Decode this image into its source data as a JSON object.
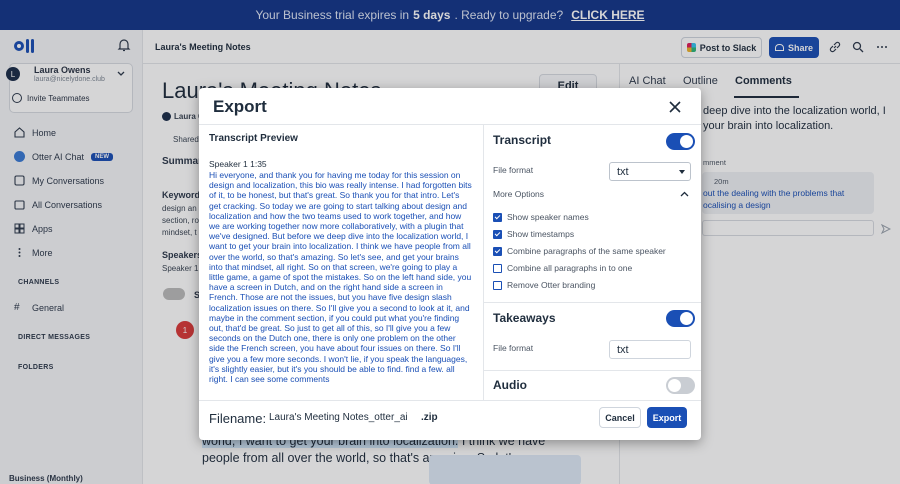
{
  "banner": {
    "prefix": "Your Business trial expires in",
    "days": "5 days",
    "mid": ". Ready to upgrade?",
    "cta": "CLICK HERE"
  },
  "sidebar": {
    "user_initial": "L",
    "user_name": "Laura Owens",
    "user_email": "laura@nicelydone.club",
    "invite": "Invite Teammates",
    "items": [
      {
        "label": "Home",
        "icon": "home-icon"
      },
      {
        "label": "Otter AI Chat",
        "icon": "otter-icon",
        "badge": "NEW"
      },
      {
        "label": "My Conversations",
        "icon": "conversations-icon"
      },
      {
        "label": "All Conversations",
        "icon": "folder-icon"
      },
      {
        "label": "Apps",
        "icon": "apps-icon"
      },
      {
        "label": "More",
        "icon": "more-icon"
      }
    ],
    "channels": "CHANNELS",
    "general": "General",
    "direct": "DIRECT MESSAGES",
    "folders": "FOLDERS",
    "plan": "Business (Monthly)"
  },
  "topbar": {
    "title": "Laura's Meeting Notes",
    "slack": "Post to Slack",
    "share": "Share"
  },
  "main_bg": {
    "title": "Laura's Meeting Notes",
    "edit": "Edit",
    "owner": "Laura O",
    "shared": "Shared",
    "summary": "Summar",
    "keywords": "Keyword",
    "kw1": "design an",
    "kw2": "section, ro",
    "kw3": "mindset, t",
    "speakers": "Speakers",
    "speaker": "Speaker 1",
    "s_label": "S",
    "speaker_num": "1",
    "transcript_a": "world, I want to get your brain into localization.",
    "transcript_b": " I think we have people from all over the world, so that's amazing. So let's"
  },
  "right_panel": {
    "tabs": [
      "AI Chat",
      "Outline",
      "Comments"
    ],
    "heading": "deep dive into the localization world, I your brain into localization.",
    "comment_label": "mment",
    "time": "20m",
    "comment_text": "out the dealing with the problems that ocalising a design"
  },
  "modal": {
    "title": "Export",
    "preview_title": "Transcript Preview",
    "speaker_line": "Speaker 1  1:35",
    "preview_text": "Hi everyone, and thank you for having me today for this session on design and localization, this bio was really intense. I had forgotten bits of it, to be honest, but that's great. So thank you for that intro. Let's get cracking. So today we are going to start talking about design and localization and how the two teams used to work together, and how we are working together now more collaboratively, with a plugin that we've designed. But before we deep dive into the localization world, I want to get your brain into localization. I think we have people from all over the world, so that's amazing. So let's see, and get your brains into that mindset, all right. So on that screen, we're going to play a little game, a game of spot the mistakes. So on the left hand side, you have a screen in Dutch, and on the right hand side a screen in French. Those are not the issues, but you have five design slash localization issues on there. So I'll give you a second to look at it, and maybe in the comment section, if you could put what you're finding out, that'd be great. So just to get all of this, so I'll give you a few seconds on the Dutch one, there is only one problem on the other side the French screen, you have about four issues on there. So I'll give you a few more seconds. I won't lie, if you speak the languages, it's slightly easier, but it's you should be able to find. find a few. all right. I can see some comments",
    "transcript": {
      "heading": "Transcript",
      "file_format_label": "File format",
      "format": "txt",
      "more_options": "More Options"
    },
    "options": [
      {
        "label": "Show speaker names",
        "checked": true
      },
      {
        "label": "Show timestamps",
        "checked": true
      },
      {
        "label": "Combine paragraphs of the same speaker",
        "checked": true
      },
      {
        "label": "Combine all paragraphs in to one",
        "checked": false
      },
      {
        "label": "Remove Otter branding",
        "checked": false
      }
    ],
    "takeaways": {
      "heading": "Takeaways",
      "file_format_label": "File format",
      "format": "txt"
    },
    "audio": {
      "heading": "Audio"
    },
    "filename_label": "Filename:",
    "filename_value": "Laura's Meeting Notes_otter_ai",
    "extension": ".zip",
    "cancel": "Cancel",
    "export": "Export"
  },
  "colors": {
    "brand": "#1a4fb5",
    "banner": "#14368a"
  }
}
